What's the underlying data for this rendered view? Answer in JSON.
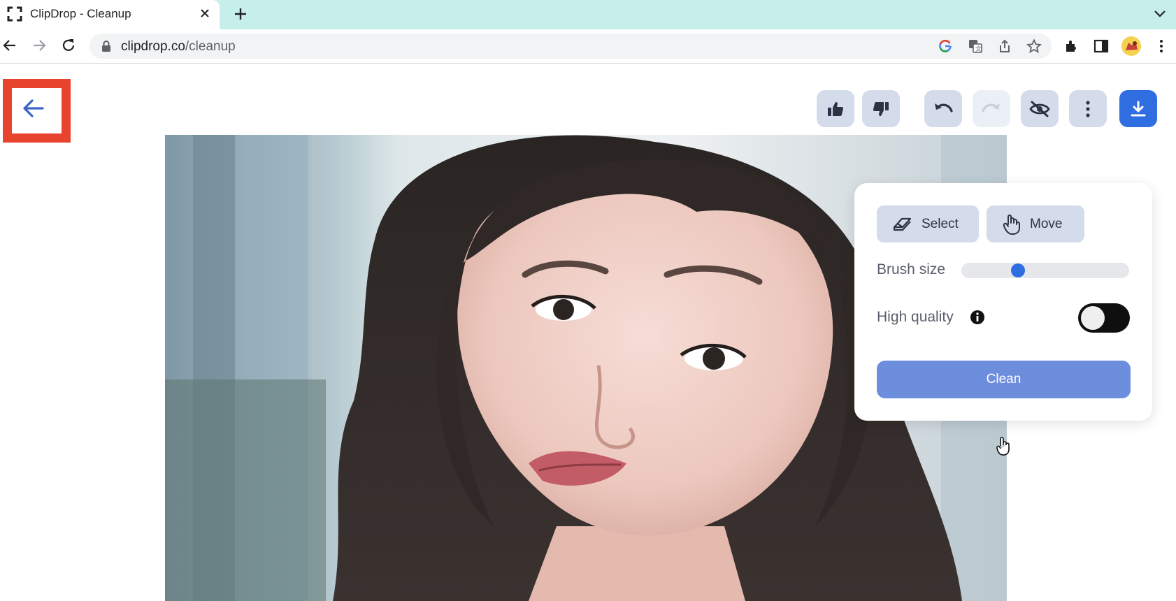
{
  "browser": {
    "tab": {
      "title": "ClipDrop - Cleanup",
      "favicon": "clipdrop-logo-icon",
      "close_icon": "close-icon"
    },
    "new_tab_icon": "plus-icon",
    "tab_menu_icon": "chevron-down-icon",
    "toolbar": {
      "back_icon": "arrow-left-icon",
      "forward_icon": "arrow-right-icon",
      "reload_icon": "reload-icon",
      "url_domain": "clipdrop.co",
      "url_path": "/cleanup",
      "lock_icon": "lock-icon",
      "omnibox_icons": [
        "google-icon",
        "translate-icon",
        "share-icon",
        "star-icon"
      ],
      "right_icons": [
        "extensions-icon",
        "side-panel-icon",
        "profile-avatar",
        "kebab-menu-icon"
      ]
    }
  },
  "page": {
    "back_button_icon": "arrow-left-icon",
    "actions": [
      {
        "name": "thumbs-up",
        "icon": "thumbs-up-icon",
        "enabled": true
      },
      {
        "name": "thumbs-down",
        "icon": "thumbs-down-icon",
        "enabled": true
      },
      {
        "name": "undo",
        "icon": "undo-icon",
        "enabled": true
      },
      {
        "name": "redo",
        "icon": "redo-icon",
        "enabled": false
      },
      {
        "name": "hide-compare",
        "icon": "eye-off-icon",
        "enabled": true
      },
      {
        "name": "more",
        "icon": "kebab-menu-icon",
        "enabled": true
      },
      {
        "name": "download",
        "icon": "download-icon",
        "enabled": true
      }
    ],
    "photo_icon": "portrait-photo"
  },
  "panel": {
    "select_label": "Select",
    "move_label": "Move",
    "brush_size_label": "Brush size",
    "brush_size_value": 0.32,
    "high_quality_label": "High quality",
    "high_quality_on": false,
    "clean_label": "Clean"
  },
  "colors": {
    "accent": "#2f6ee0",
    "clean_button": "#6d8ddd",
    "highlight_box": "#e8432d",
    "tabstrip": "#c6efec"
  }
}
